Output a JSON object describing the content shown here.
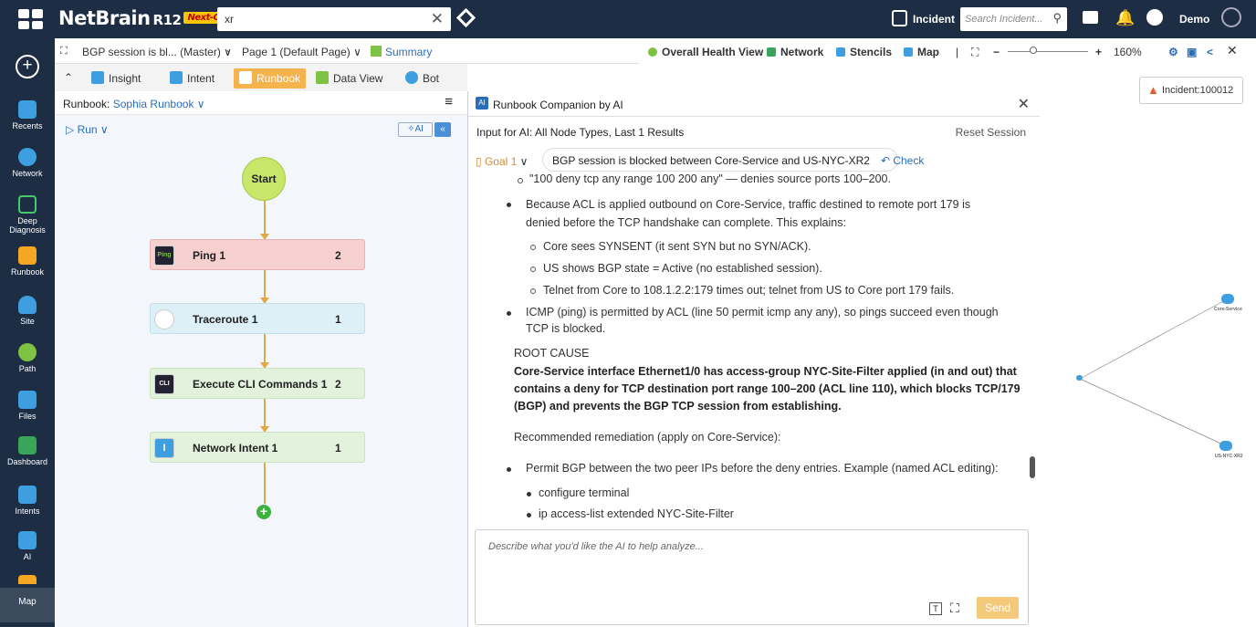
{
  "topbar": {
    "brand": "NetBrain",
    "version": "R12",
    "badge": "Next-Gen",
    "tab_search": "xr",
    "incident_label": "Incident",
    "incident_search_placeholder": "Search Incident...",
    "user": "Demo"
  },
  "sidebar": {
    "items": [
      {
        "label": "Recents"
      },
      {
        "label": "Network"
      },
      {
        "label": "Deep Diagnosis"
      },
      {
        "label": "Runbook"
      },
      {
        "label": "Site"
      },
      {
        "label": "Path"
      },
      {
        "label": "Files"
      },
      {
        "label": "Dashboard"
      },
      {
        "label": "Intents"
      },
      {
        "label": "AI"
      }
    ],
    "map": "Map"
  },
  "breadcrumb": {
    "title": "BGP session is bl... (Master) ∨",
    "page": "Page 1 (Default Page) ∨",
    "summary": "Summary"
  },
  "toolbar": {
    "health": "Overall Health View",
    "network": "Network",
    "stencils": "Stencils",
    "map": "Map",
    "zoom": "160%"
  },
  "tabs": [
    {
      "label": "Insight"
    },
    {
      "label": "Intent"
    },
    {
      "label": "Runbook"
    },
    {
      "label": "Data View"
    },
    {
      "label": "Bot"
    }
  ],
  "runbook": {
    "title_prefix": "Runbook:",
    "name": "Sophia Runbook ∨",
    "run": "▷ Run ∨",
    "ai": "✧AI",
    "start": "Start",
    "nodes": [
      {
        "name": "Ping 1",
        "count": "2",
        "icon": "Ping"
      },
      {
        "name": "Traceroute 1",
        "count": "1",
        "icon": ""
      },
      {
        "name": "Execute CLI Commands 1",
        "count": "2",
        "icon": "CLI"
      },
      {
        "name": "Network Intent 1",
        "count": "1",
        "icon": "I"
      }
    ]
  },
  "ai_panel": {
    "title": "Runbook Companion by AI",
    "input_for_ai": "Input for AI: All Node Types, Last 1 Results",
    "reset": "Reset Session",
    "goal": "Goal 1",
    "goal_text": "BGP session is blocked between Core-Service and US-NYC-XR2",
    "check": "Check",
    "lines": [
      "\"100 deny tcp any range 100 200 any\" — denies source ports 100–200.",
      "Because ACL is applied outbound on Core-Service, traffic destined to remote port 179 is",
      "denied before the TCP handshake can complete. This explains:",
      "Core sees SYNSENT (it sent SYN but no SYN/ACK).",
      "US shows BGP state = Active (no established session).",
      "Telnet from Core to 108.1.2.2:179 times out; telnet from US to Core port 179 fails.",
      "ICMP (ping) is permitted by ACL (line 50 permit icmp any any), so pings succeed even though",
      "TCP is blocked.",
      "ROOT CAUSE",
      "Core-Service interface Ethernet1/0 has access-group NYC-Site-Filter applied (in and out) that",
      "contains a deny for TCP destination port range 100–200 (ACL line 110), which blocks TCP/179",
      "(BGP) and prevents the BGP TCP session from establishing.",
      "Recommended remediation (apply on Core-Service):",
      "Permit BGP between the two peer IPs before the deny entries. Example (named ACL editing):",
      "configure terminal",
      "ip access-list extended NYC-Site-Filter"
    ],
    "composer_placeholder": "Describe what you'd like the AI to help analyze...",
    "send": "Send"
  },
  "map": {
    "incident": "Incident:100012",
    "nodes": [
      {
        "label": "Core-Service"
      },
      {
        "label": "US-NYC-XR2"
      }
    ]
  }
}
